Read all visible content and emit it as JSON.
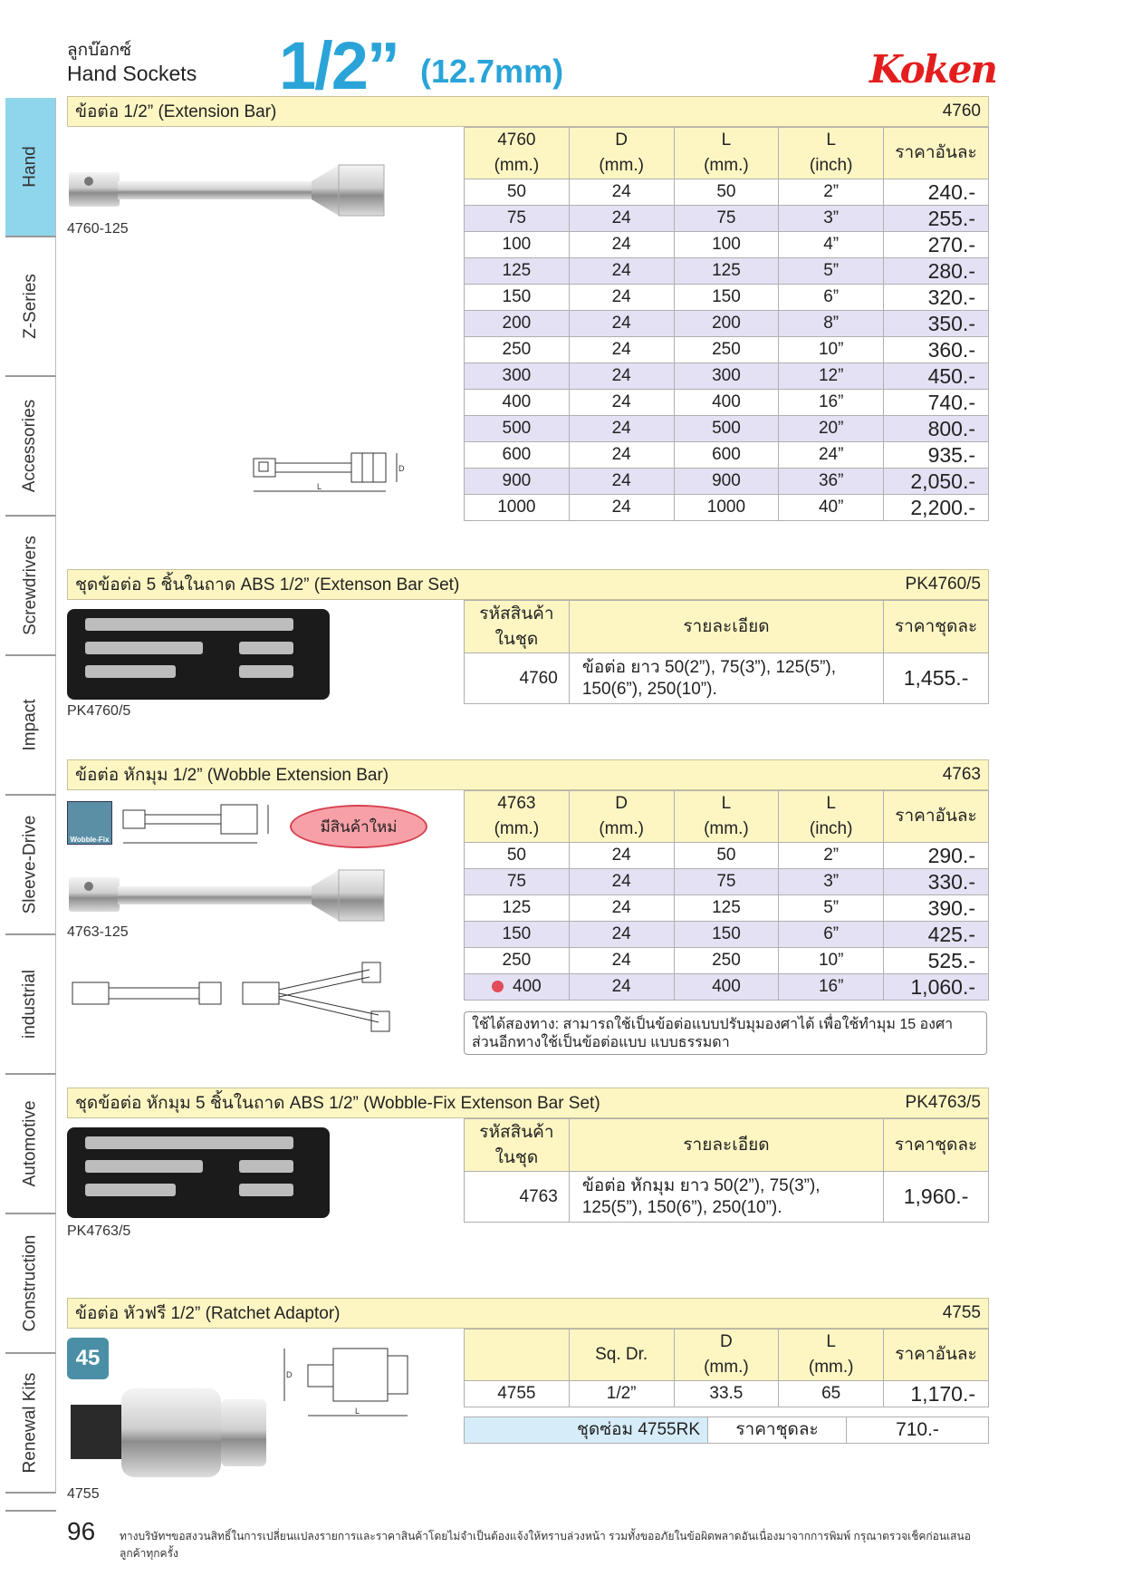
{
  "header": {
    "thai": "ลูกบ๊อกซ์",
    "eng": "Hand Sockets",
    "size": "1/2”",
    "mm": "(12.7mm)",
    "brand": "Koken"
  },
  "sidetabs": [
    "Hand",
    "Z-Series",
    "Accessories",
    "Screwdrivers",
    "Impact",
    "Sleeve-Drive",
    "industrial",
    "Automotive",
    "Construction",
    "Renewal Kits"
  ],
  "s1": {
    "title": "ข้อต่อ 1/2” (Extension Bar)",
    "code": "4760",
    "caption": "4760-125",
    "head": [
      "4760",
      "(mm.)",
      "D",
      "(mm.)",
      "L",
      "(mm.)",
      "L",
      "(inch)",
      "ราคาอันละ"
    ],
    "rows": [
      [
        "50",
        "24",
        "50",
        "2”",
        "240.-"
      ],
      [
        "75",
        "24",
        "75",
        "3”",
        "255.-"
      ],
      [
        "100",
        "24",
        "100",
        "4”",
        "270.-"
      ],
      [
        "125",
        "24",
        "125",
        "5”",
        "280.-"
      ],
      [
        "150",
        "24",
        "150",
        "6”",
        "320.-"
      ],
      [
        "200",
        "24",
        "200",
        "8”",
        "350.-"
      ],
      [
        "250",
        "24",
        "250",
        "10”",
        "360.-"
      ],
      [
        "300",
        "24",
        "300",
        "12”",
        "450.-"
      ],
      [
        "400",
        "24",
        "400",
        "16”",
        "740.-"
      ],
      [
        "500",
        "24",
        "500",
        "20”",
        "800.-"
      ],
      [
        "600",
        "24",
        "600",
        "24”",
        "935.-"
      ],
      [
        "900",
        "24",
        "900",
        "36”",
        "2,050.-"
      ],
      [
        "1000",
        "24",
        "1000",
        "40”",
        "2,200.-"
      ]
    ]
  },
  "s2": {
    "title": "ชุดข้อต่อ 5 ชิ้นในถาด ABS 1/2” (Extenson Bar Set)",
    "code": "PK4760/5",
    "caption": "PK4760/5",
    "head": [
      "รหัสสินค้า",
      "ในชุด",
      "รายละเอียด",
      "ราคาชุดละ"
    ],
    "row": [
      "4760",
      "ข้อต่อ ยาว 50(2”), 75(3”), 125(5”),",
      "150(6”), 250(10”).",
      "1,455.-"
    ]
  },
  "s3": {
    "title": "ข้อต่อ หักมุม 1/2” (Wobble Extension Bar)",
    "code": "4763",
    "caption": "4763-125",
    "badge": "มีสินค้าใหม่",
    "logo": "Wobble-Fix",
    "head": [
      "4763",
      "(mm.)",
      "D",
      "(mm.)",
      "L",
      "(mm.)",
      "L",
      "(inch)",
      "ราคาอันละ"
    ],
    "rows": [
      [
        "50",
        "24",
        "50",
        "2”",
        "290.-"
      ],
      [
        "75",
        "24",
        "75",
        "3”",
        "330.-"
      ],
      [
        "125",
        "24",
        "125",
        "5”",
        "390.-"
      ],
      [
        "150",
        "24",
        "150",
        "6”",
        "425.-"
      ],
      [
        "250",
        "24",
        "250",
        "10”",
        "525.-"
      ],
      [
        "400",
        "24",
        "400",
        "16”",
        "1,060.-"
      ]
    ],
    "note1": "ใช้ได้สองทาง: สามารถใช้เป็นข้อต่อแบบปรับมุมองศาได้ เพื่อใช้ทำมุม 15 องศา",
    "note2": "ส่วนอีกทางใช้เป็นข้อต่อแบบ แบบธรรมดา"
  },
  "s4": {
    "title": "ชุดข้อต่อ หักมุม 5 ชิ้นในถาด ABS 1/2” (Wobble-Fix Extenson Bar Set)",
    "code": "PK4763/5",
    "caption": "PK4763/5",
    "head": [
      "รหัสสินค้า",
      "ในชุด",
      "รายละเอียด",
      "ราคาชุดละ"
    ],
    "row": [
      "4763",
      "ข้อต่อ หักมุม ยาว 50(2”), 75(3”),",
      "125(5”), 150(6”), 250(10”).",
      "1,960.-"
    ]
  },
  "s5": {
    "title": "ข้อต่อ หัวฟรี 1/2” (Ratchet Adaptor)",
    "code": "4755",
    "caption": "4755",
    "badge45": "45",
    "head": [
      "Sq. Dr.",
      "D",
      "(mm.)",
      "L",
      "(mm.)",
      "ราคาอันละ"
    ],
    "row": [
      "4755",
      "1/2”",
      "33.5",
      "65",
      "1,170.-"
    ],
    "rk": [
      "ชุดซ่อม 4755RK",
      "ราคาชุดละ",
      "710.-"
    ]
  },
  "footer": {
    "page": "96",
    "note": "ทางบริษัทฯขอสงวนสิทธิ์ในการเปลี่ยนแปลงรายการและราคาสินค้าโดยไม่จำเป็นต้องแจ้งให้ทราบล่วงหน้า รวมทั้งขออภัยในข้อผิดพลาดอันเนื่องมาจากการพิมพ์ กรุณาตรวจเช็คก่อนเสนอลูกค้าทุกครั้ง"
  }
}
